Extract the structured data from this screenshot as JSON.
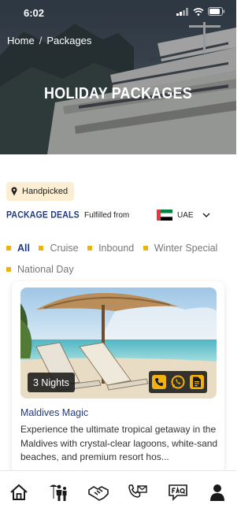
{
  "status": {
    "time": "6:02"
  },
  "breadcrumb": {
    "home": "Home",
    "separator": "/",
    "current": "Packages"
  },
  "hero": {
    "title": "HOLIDAY PACKAGES"
  },
  "handpicked": {
    "label": "Handpicked",
    "icon": "pin-icon"
  },
  "deals": {
    "title": "PACKAGE DEALS",
    "fulfilled_label": "Fulfilled from",
    "country": "UAE",
    "country_flag": "uae-flag-icon"
  },
  "filters": [
    {
      "label": "All",
      "active": true
    },
    {
      "label": "Cruise",
      "active": false
    },
    {
      "label": "Inbound",
      "active": false
    },
    {
      "label": "Winter Special",
      "active": false
    },
    {
      "label": "National Day",
      "active": false
    }
  ],
  "package": {
    "nights": "3 Nights",
    "title": "Maldives Magic",
    "description": "Experience the ultimate tropical getaway in the Maldives with crystal-clear lagoons, white-sand beaches, and premium resort hos...",
    "actions": [
      "phone-icon",
      "whatsapp-icon",
      "document-icon"
    ]
  },
  "bottom_nav": [
    {
      "icon": "home-icon"
    },
    {
      "icon": "holiday-people-icon"
    },
    {
      "icon": "handshake-icon"
    },
    {
      "icon": "call-mail-icon"
    },
    {
      "icon": "faq-icon"
    },
    {
      "icon": "user-icon"
    }
  ],
  "colors": {
    "accent": "#1f3a86",
    "highlight": "#f2b10c",
    "badge_bg": "#fbeed3"
  }
}
